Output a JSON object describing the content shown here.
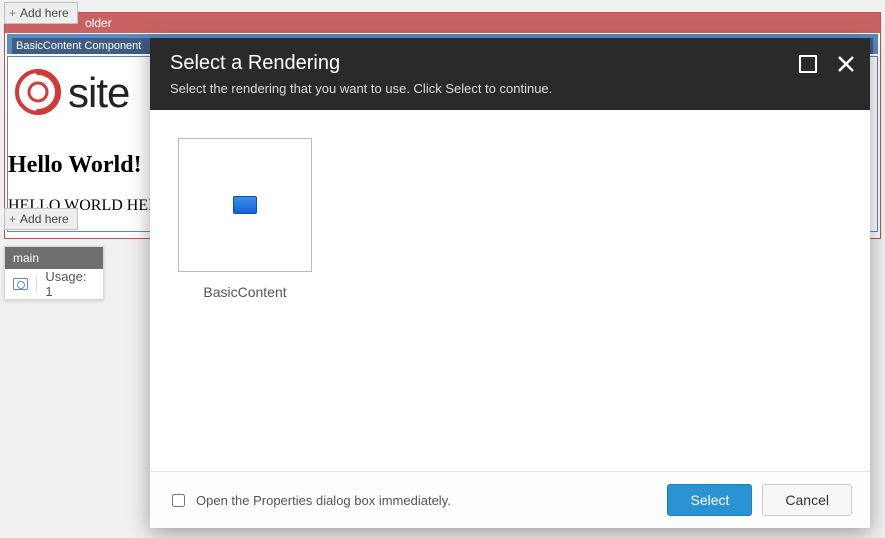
{
  "placeholder": {
    "add_here_label": "Add here",
    "name_truncated": "older"
  },
  "component": {
    "label": "BasicContent Component",
    "logo_text_truncated": "site",
    "hello_heading": "Hello World!",
    "hello_sub_truncated": "HELLO WORLD HEL"
  },
  "sidebar_card": {
    "tab_label": "main",
    "usage_label": "Usage: 1"
  },
  "dialog": {
    "title": "Select a Rendering",
    "subtitle": "Select the rendering that you want to use. Click Select to continue.",
    "renderings": [
      {
        "label": "BasicContent"
      }
    ],
    "footer": {
      "open_properties_label": "Open the Properties dialog box immediately.",
      "select_label": "Select",
      "cancel_label": "Cancel"
    }
  }
}
